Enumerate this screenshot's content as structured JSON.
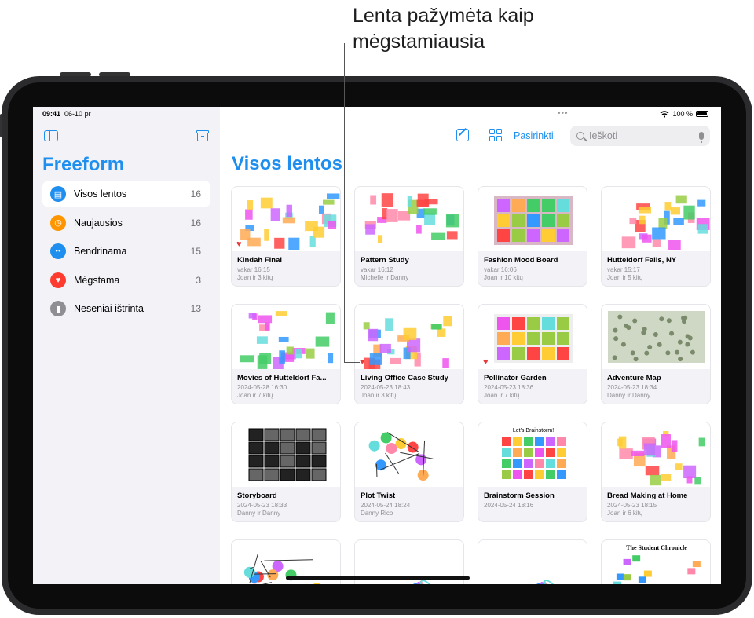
{
  "annotation": {
    "line1": "Lenta pažymėta kaip",
    "line2": "mėgstamiausia"
  },
  "status": {
    "time": "09:41",
    "date": "06-10 pr",
    "battery": "100 %"
  },
  "sidebar": {
    "app_title": "Freeform",
    "items": [
      {
        "label": "Visos lentos",
        "count": "16",
        "color": "#1e8fef",
        "icon": "boards-icon"
      },
      {
        "label": "Naujausios",
        "count": "16",
        "color": "#ff9500",
        "icon": "clock-icon"
      },
      {
        "label": "Bendrinama",
        "count": "15",
        "color": "#1e8fef",
        "icon": "people-icon"
      },
      {
        "label": "Mėgstama",
        "count": "3",
        "color": "#ff3b30",
        "icon": "heart-icon"
      },
      {
        "label": "Neseniai ištrinta",
        "count": "13",
        "color": "#8e8e93",
        "icon": "trash-icon"
      }
    ]
  },
  "toolbar": {
    "select_label": "Pasirinkti",
    "search_placeholder": "Ieškoti"
  },
  "main": {
    "title": "Visos lentos"
  },
  "boards": [
    {
      "name": "Kindah Final",
      "date": "vakar 16:15",
      "people": "Joan ir 3 kitų",
      "favorite": true
    },
    {
      "name": "Pattern Study",
      "date": "vakar 16:12",
      "people": "Michelle ir Danny",
      "favorite": false
    },
    {
      "name": "Fashion Mood Board",
      "date": "vakar 16:06",
      "people": "Joan ir 10 kitų",
      "favorite": false
    },
    {
      "name": "Hutteldorf Falls, NY",
      "date": "vakar 15:17",
      "people": "Joan ir 5 kitų",
      "favorite": false
    },
    {
      "name": "Movies of Hutteldorf Fa...",
      "date": "2024-05-28 16:30",
      "people": "Joan ir 7 kitų",
      "favorite": false
    },
    {
      "name": "Living Office Case Study",
      "date": "2024-05-23 18:43",
      "people": "Joan ir 3 kitų",
      "favorite": true
    },
    {
      "name": "Pollinator Garden",
      "date": "2024-05-23 18:36",
      "people": "Joan ir 7 kitų",
      "favorite": true
    },
    {
      "name": "Adventure Map",
      "date": "2024-05-23 18:34",
      "people": "Danny ir Danny",
      "favorite": false
    },
    {
      "name": "Storyboard",
      "date": "2024-05-23 18:33",
      "people": "Danny ir Danny",
      "favorite": false
    },
    {
      "name": "Plot Twist",
      "date": "2024-05-24 18:24",
      "people": "Danny Rico",
      "favorite": false
    },
    {
      "name": "Brainstorm Session",
      "date": "2024-05-24 18:16",
      "people": "",
      "favorite": false
    },
    {
      "name": "Bread Making at Home",
      "date": "2024-05-23 18:15",
      "people": "Joan ir 6 kitų",
      "favorite": false
    },
    {
      "name": "",
      "date": "",
      "people": "",
      "favorite": false
    },
    {
      "name": "",
      "date": "",
      "people": "",
      "favorite": false
    },
    {
      "name": "",
      "date": "",
      "people": "",
      "favorite": false
    },
    {
      "name": "",
      "date": "",
      "people": "",
      "favorite": false
    }
  ],
  "thumbs": {
    "t2_title": "Let's Brainstorm!",
    "t15_title": "The Student Chronicle"
  }
}
